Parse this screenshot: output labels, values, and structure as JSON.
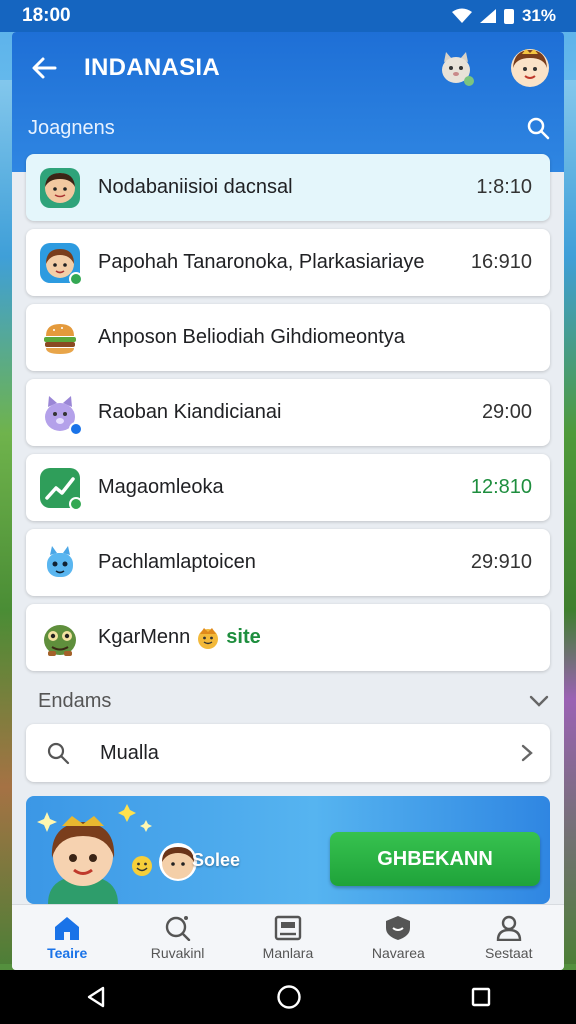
{
  "status_bar": {
    "time": "18:00",
    "battery": "31%"
  },
  "header": {
    "title": "INDANASIA",
    "subtitle": "Joagnens"
  },
  "list": [
    {
      "label": "Nodabaniisioi dacnsal",
      "time": "1:8:10",
      "icon": "avatar-icon",
      "active": true
    },
    {
      "label": "Papohah Tanaronoka, Plarkasiariaye",
      "time": "16:910",
      "icon": "avatar-icon"
    },
    {
      "label": "Anposon Beliodiah Gihdiomeontya",
      "time": "",
      "icon": "burger-icon"
    },
    {
      "label": "Raoban Kiandicianai",
      "time": "29:00",
      "icon": "cat-icon"
    },
    {
      "label": "Magaomleoka",
      "time": "12:810",
      "icon": "chart-icon",
      "time_color": "green"
    },
    {
      "label": "Pachlamlaptoicen",
      "time": "29:910",
      "icon": "bot-icon"
    },
    {
      "label": "KgarMenn",
      "time": "",
      "icon": "monster-icon",
      "tag": "site"
    }
  ],
  "section": {
    "title": "Endams"
  },
  "search": {
    "label": "Mualla"
  },
  "promo": {
    "text": "Solee",
    "button": "GHBEKANN"
  },
  "bottom_nav": [
    {
      "label": "Teaire",
      "icon": "home-icon",
      "active": true
    },
    {
      "label": "Ruvakinl",
      "icon": "search-icon"
    },
    {
      "label": "Manlara",
      "icon": "gallery-icon"
    },
    {
      "label": "Navarea",
      "icon": "shield-icon"
    },
    {
      "label": "Sestaat",
      "icon": "person-icon"
    }
  ],
  "colors": {
    "primary": "#1e6fd6",
    "accent_green": "#1fa33a",
    "active_nav": "#1a73e8"
  }
}
